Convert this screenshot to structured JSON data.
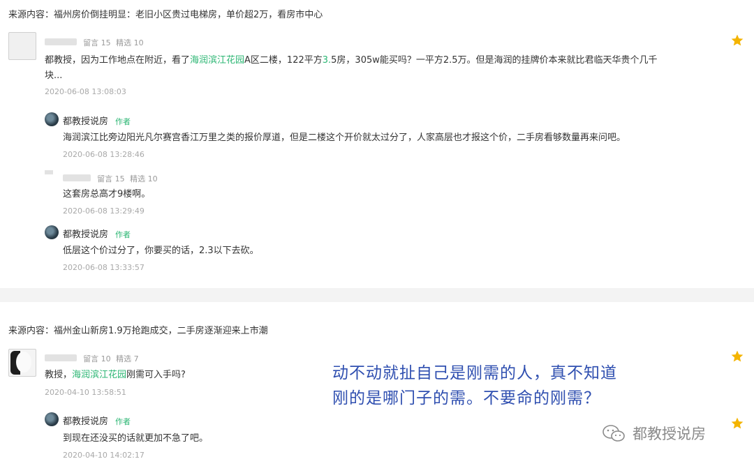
{
  "thread1": {
    "source": "来源内容：福州房价倒挂明显：老旧小区贵过电梯房，单价超2万，看房市中心",
    "comment": {
      "stats_messages": "留言 15",
      "stats_featured": "精选 10",
      "text_a": "都教授，因为工作地点在附近，看了",
      "highlight": "海润滨江花园",
      "text_b": "A区二楼，122平方",
      "highlight2": "3.",
      "text_c": "5房，305w能买吗？一平方2.5万。但是海润的挂牌价本来就比君临天华贵个几千",
      "text_d": "块...",
      "time": "2020-06-08 13:08:03"
    },
    "reply1": {
      "author": "都教授说房",
      "tag": "作者",
      "text": "海润滨江比旁边阳光凡尔赛宫香江万里之类的报价厚道，但是二楼这个开价就太过分了，人家高层也才报这个价，二手房看够数量再来问吧。",
      "time": "2020-06-08 13:28:46"
    },
    "followup": {
      "stats_messages": "留言 15",
      "stats_featured": "精选 10",
      "text": "这套房总高才9楼啊。",
      "time": "2020-06-08 13:29:49"
    },
    "reply2": {
      "author": "都教授说房",
      "tag": "作者",
      "text": "低层这个价过分了，你要买的话，2.3以下去砍。",
      "time": "2020-06-08 13:33:57"
    }
  },
  "thread2": {
    "source": "来源内容：福州金山新房1.9万抢跑成交，二手房逐渐迎来上市潮",
    "comment": {
      "stats_messages": "留言 10",
      "stats_featured": "精选 7",
      "text_a": "教授，",
      "highlight": "海润滨江花园",
      "text_b": "刚需可入手吗?",
      "time": "2020-04-10 13:58:51"
    },
    "reply1": {
      "author": "都教授说房",
      "tag": "作者",
      "text": "到现在还没买的话就更加不急了吧。",
      "time": "2020-04-10 14:02:17"
    }
  },
  "overlay": {
    "line1": "动不动就扯自己是刚需的人，真不知道",
    "line2": "刚的是哪门子的需。不要命的刚需？"
  },
  "watermark": {
    "text": "都教授说房",
    "icon": "wechat-icon"
  },
  "colors": {
    "highlight": "#2bb673",
    "star": "#f4b400",
    "overlay_text": "#2f4fb0",
    "author_tag": "#2bb673"
  }
}
